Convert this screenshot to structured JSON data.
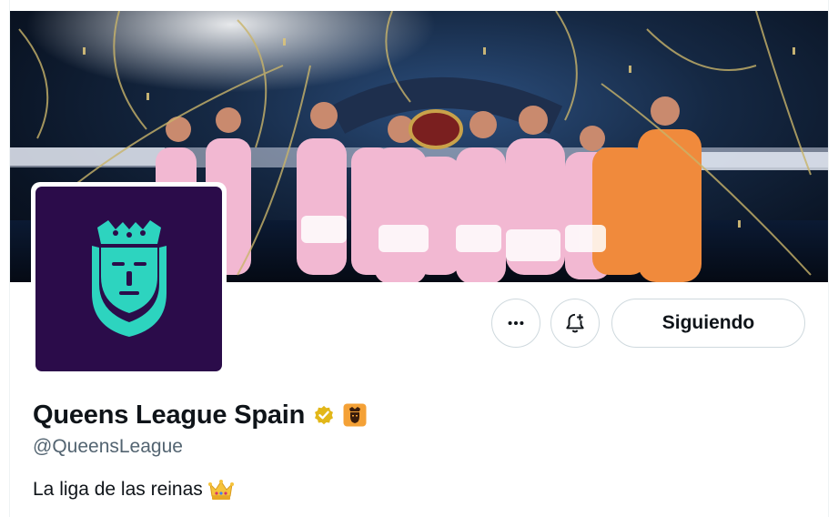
{
  "profile": {
    "display_name": "Queens League Spain",
    "handle": "@QueensLeague",
    "bio": "La liga de las reinas",
    "bio_emoji": "crown-emoji",
    "verified_badge": "gold-verified-badge",
    "affiliate_badge": "queens-league-affiliate-badge"
  },
  "banner": {
    "description_icon": "team-celebration-photo"
  },
  "actions": {
    "more_icon": "more-horizontal-icon",
    "notify_icon": "bell-plus-icon",
    "following_label": "Siguiendo"
  },
  "colors": {
    "avatar_bg": "#2b0c4a",
    "logo_teal": "#2dd4bf",
    "verified_gold": "#e2b719",
    "text_primary": "#0f1419",
    "text_secondary": "#536471",
    "border": "#cfd9de"
  }
}
